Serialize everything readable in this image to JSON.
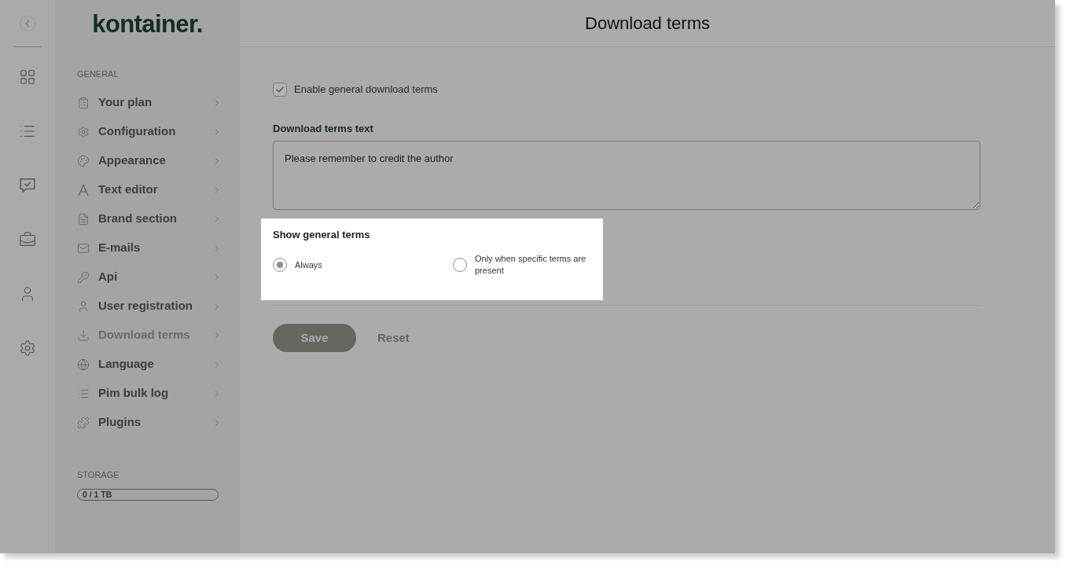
{
  "sidebar": {
    "logo": "kontainer.",
    "section_label": "GENERAL",
    "items": [
      {
        "label": "Your plan",
        "selected": false
      },
      {
        "label": "Configuration",
        "selected": false
      },
      {
        "label": "Appearance",
        "selected": false
      },
      {
        "label": "Text editor",
        "selected": false
      },
      {
        "label": "Brand section",
        "selected": false
      },
      {
        "label": "E-mails",
        "selected": false
      },
      {
        "label": "Api",
        "selected": false
      },
      {
        "label": "User registration",
        "selected": false
      },
      {
        "label": "Download terms",
        "selected": true
      },
      {
        "label": "Language",
        "selected": false
      },
      {
        "label": "Pim bulk log",
        "selected": false
      },
      {
        "label": "Plugins",
        "selected": false
      }
    ],
    "storage": {
      "label": "STORAGE",
      "reading": "0 / 1 TB"
    }
  },
  "page": {
    "title": "Download terms"
  },
  "form": {
    "enable_terms": {
      "label": "Enable general download terms",
      "checked": true
    },
    "terms_text": {
      "label": "Download terms text",
      "value": "Please remember to credit the author"
    },
    "show_general_terms": {
      "label": "Show general terms",
      "options": [
        {
          "label": "Always",
          "selected": true
        },
        {
          "label": "Only when specific terms are present",
          "selected": false
        }
      ]
    },
    "buttons": [
      {
        "label": "Save",
        "kind": "primary"
      },
      {
        "label": "Reset",
        "kind": "link"
      }
    ]
  }
}
